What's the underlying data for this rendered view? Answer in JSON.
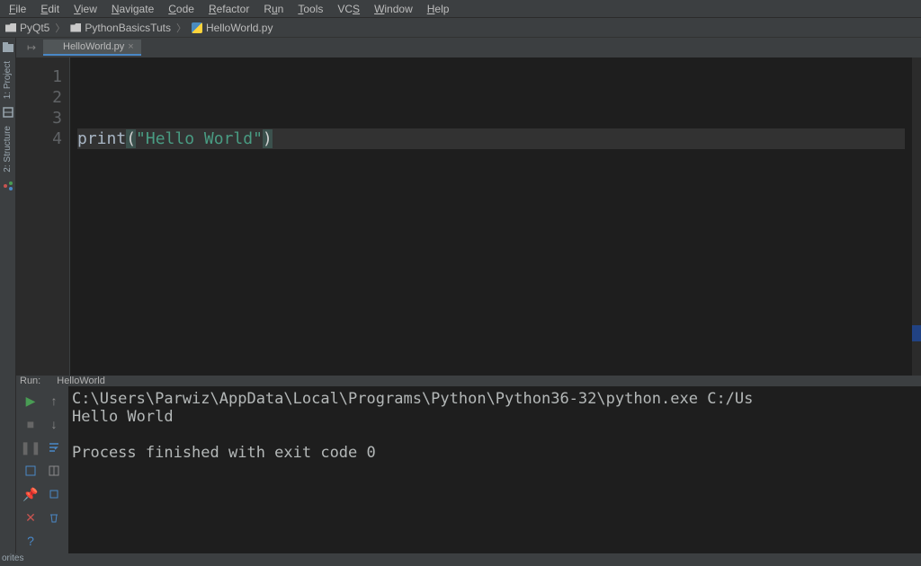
{
  "menu": {
    "items": [
      "File",
      "Edit",
      "View",
      "Navigate",
      "Code",
      "Refactor",
      "Run",
      "Tools",
      "VCS",
      "Window",
      "Help"
    ]
  },
  "breadcrumbs": {
    "root": "PyQt5",
    "mid": "PythonBasicsTuts",
    "file": "HelloWorld.py"
  },
  "left_tools": {
    "project": "1: Project",
    "structure": "2: Structure"
  },
  "tab": {
    "label": "HelloWorld.py"
  },
  "gutter": {
    "lines": [
      "1",
      "2",
      "3",
      "4"
    ]
  },
  "code": {
    "fn": "print",
    "open": "(",
    "str": "\"Hello World\"",
    "close": ")"
  },
  "run": {
    "header_label": "Run:",
    "config": "HelloWorld",
    "line1": "C:\\Users\\Parwiz\\AppData\\Local\\Programs\\Python\\Python36-32\\python.exe C:/Us",
    "line2": "Hello World",
    "line3": "",
    "line4": "Process finished with exit code 0"
  },
  "status": {
    "favorites": "orites"
  }
}
